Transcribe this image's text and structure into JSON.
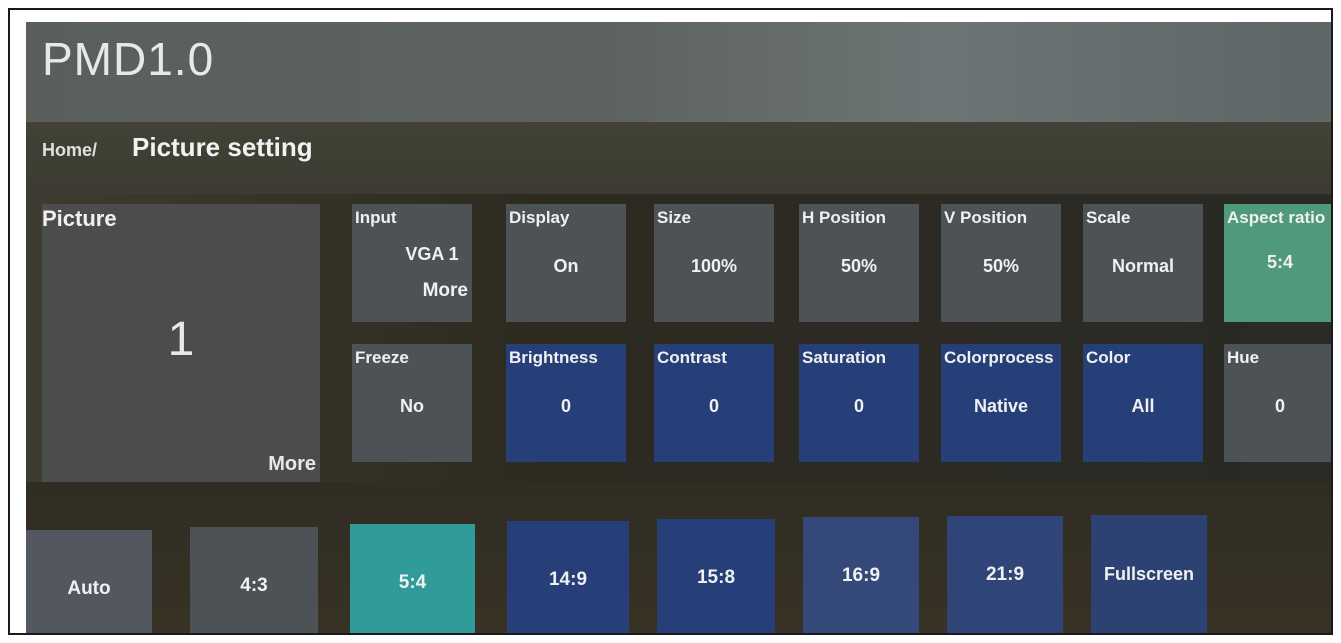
{
  "app": {
    "title": "PMD1.0"
  },
  "breadcrumb": {
    "home": "Home/",
    "current": "Picture setting"
  },
  "picture": {
    "label": "Picture",
    "number": "1",
    "more": "More"
  },
  "row1": [
    {
      "label": "Input",
      "value": "VGA 1",
      "more": "More"
    },
    {
      "label": "Display",
      "value": "On"
    },
    {
      "label": "Size",
      "value": "100%"
    },
    {
      "label": "H Position",
      "value": "50%"
    },
    {
      "label": "V Position",
      "value": "50%"
    },
    {
      "label": "Scale",
      "value": "Normal"
    },
    {
      "label": "Aspect ratio",
      "value": "5:4"
    }
  ],
  "row2": [
    {
      "label": "Freeze",
      "value": "No"
    },
    {
      "label": "Brightness",
      "value": "0"
    },
    {
      "label": "Contrast",
      "value": "0"
    },
    {
      "label": "Saturation",
      "value": "0"
    },
    {
      "label": "Colorprocess",
      "value": "Native"
    },
    {
      "label": "Color",
      "value": "All"
    },
    {
      "label": "Hue",
      "value": "0"
    }
  ],
  "aspect_options": [
    "Auto",
    "4:3",
    "5:4",
    "14:9",
    "15:8",
    "16:9",
    "21:9",
    "Fullscreen"
  ],
  "colors": {
    "selected": "#2f9c99",
    "aspect_active": "#4e9a7a",
    "tile_blue": "#263f78",
    "tile_gray": "#4d5257"
  }
}
